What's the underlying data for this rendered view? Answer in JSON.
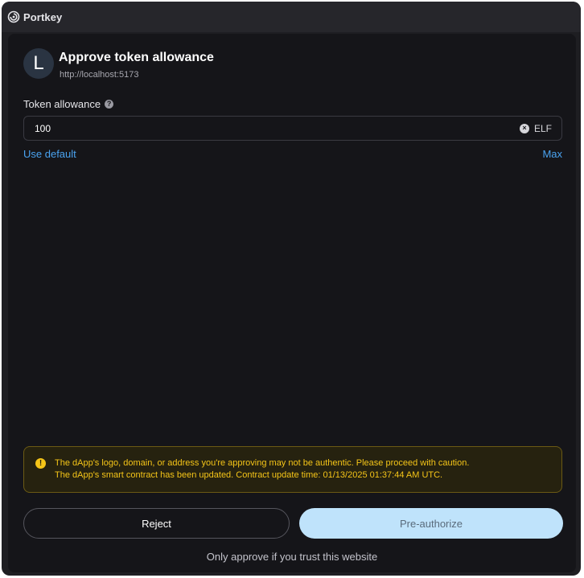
{
  "titlebar": {
    "app_name": "Portkey",
    "icon": "portkey-logo-icon"
  },
  "header": {
    "avatar_letter": "L",
    "title": "Approve token allowance",
    "url": "http://localhost:5173"
  },
  "allowance": {
    "label": "Token allowance",
    "help_icon_glyph": "?",
    "value": "100",
    "clear_icon_glyph": "×",
    "token_symbol": "ELF",
    "use_default_label": "Use default",
    "max_label": "Max"
  },
  "warning": {
    "icon_glyph": "!",
    "line1": "The dApp's logo, domain, or address you're approving may not be authentic. Please proceed with caution.",
    "line2": "The dApp's smart contract has been updated. Contract update time: 01/13/2025 01:37:44 AM UTC."
  },
  "actions": {
    "reject_label": "Reject",
    "preauthorize_label": "Pre-authorize"
  },
  "footer": {
    "note": "Only approve if you trust this website"
  },
  "colors": {
    "window_bg": "#1e1e22",
    "panel_bg": "#151519",
    "link": "#4aa3f0",
    "warning_text": "#f5c518",
    "primary_button": "#bfe3fb"
  }
}
